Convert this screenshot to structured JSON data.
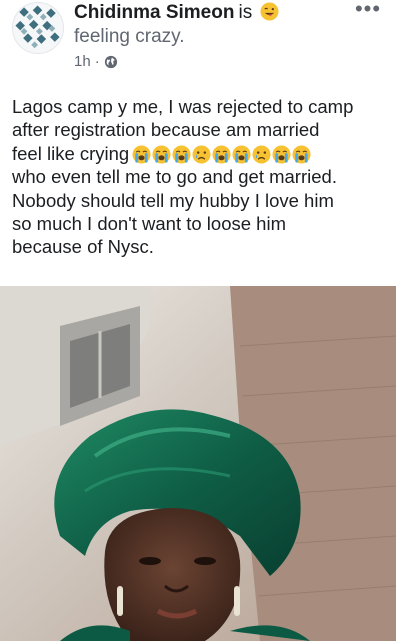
{
  "post": {
    "author": "Chidinma Simeon",
    "verb": "is",
    "feeling": "feeling crazy.",
    "time": "1h",
    "separator": "·",
    "privacy_icon": "globe-icon",
    "more_icon": "more-options-icon",
    "more_glyph": "•••",
    "text_lines": [
      "Lagos camp y me, I was rejected to camp",
      "after registration because am married",
      "feel like crying",
      "who even tell me to go and get married.",
      "Nobody should tell my hubby I love him",
      "so much I don't want to loose him",
      "because of Nysc."
    ],
    "crying_emojis": [
      "loudly-crying-face",
      "loudly-crying-face",
      "loudly-crying-face",
      "crying-face",
      "loudly-crying-face",
      "loudly-crying-face",
      "crying-face",
      "loudly-crying-face",
      "loudly-crying-face"
    ],
    "feeling_emoji": "winking-face-with-tongue",
    "photo": "woman-in-green-gele-headwrap"
  },
  "colors": {
    "text": "#1c1e21",
    "secondary": "#606770",
    "emoji_yellow": "#f7c232",
    "gele_green": "#0f5e46"
  }
}
